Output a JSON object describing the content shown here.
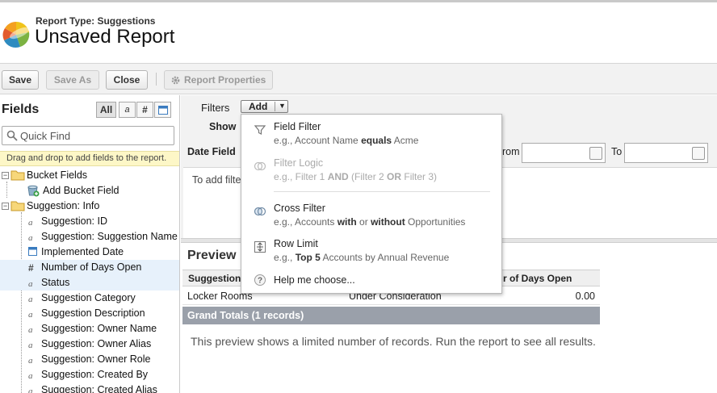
{
  "header": {
    "report_type": "Report Type: Suggestions",
    "title": "Unsaved Report"
  },
  "toolbar": {
    "save_label": "Save",
    "save_as_label": "Save As",
    "close_label": "Close",
    "report_properties_label": "Report Properties"
  },
  "fields_panel": {
    "title": "Fields",
    "toggles": [
      "All",
      "a",
      "#",
      "cal"
    ],
    "quick_find_placeholder": "Quick Find",
    "hint": "Drag and drop to add fields to the report.",
    "tree": [
      {
        "label": "Bucket Fields",
        "type": "folder",
        "icon": "folder-icon"
      },
      {
        "label": "Add Bucket Field",
        "type": "item",
        "icon": "add-bucket-icon"
      },
      {
        "label": "Suggestion: Info",
        "type": "folder",
        "icon": "folder-icon"
      },
      {
        "label": "Suggestion: ID",
        "type": "item",
        "icon": "text-field-icon"
      },
      {
        "label": "Suggestion: Suggestion Name",
        "type": "item",
        "icon": "text-field-icon"
      },
      {
        "label": "Implemented Date",
        "type": "item",
        "icon": "date-field-icon"
      },
      {
        "label": "Number of Days Open",
        "type": "item",
        "icon": "number-field-icon",
        "selected": true
      },
      {
        "label": "Status",
        "type": "item",
        "icon": "text-field-icon",
        "selected": true
      },
      {
        "label": "Suggestion Category",
        "type": "item",
        "icon": "text-field-icon"
      },
      {
        "label": "Suggestion Description",
        "type": "item",
        "icon": "text-field-icon"
      },
      {
        "label": "Suggestion: Owner Name",
        "type": "item",
        "icon": "text-field-icon"
      },
      {
        "label": "Suggestion: Owner Alias",
        "type": "item",
        "icon": "text-field-icon"
      },
      {
        "label": "Suggestion: Owner Role",
        "type": "item",
        "icon": "text-field-icon"
      },
      {
        "label": "Suggestion: Created By",
        "type": "item",
        "icon": "text-field-icon"
      },
      {
        "label": "Suggestion: Created Alias",
        "type": "item",
        "icon": "text-field-icon"
      }
    ]
  },
  "filters": {
    "filters_label": "Filters",
    "add_label": "Add",
    "show_label": "Show",
    "date_field_label": "Date Field",
    "from_label": "rom",
    "to_label": "To",
    "add_hint": "To add filte"
  },
  "add_menu": [
    {
      "title": "Field Filter",
      "sub_parts": [
        [
          "e.g., Account Name ",
          false
        ],
        [
          "equals",
          true
        ],
        [
          " Acme",
          false
        ]
      ],
      "icon": "funnel-icon",
      "disabled": false
    },
    {
      "title": "Filter Logic",
      "sub_parts": [
        [
          "e.g., Filter 1 ",
          false
        ],
        [
          "AND",
          true
        ],
        [
          " (Filter 2 ",
          false
        ],
        [
          "OR",
          true
        ],
        [
          " Filter 3)",
          false
        ]
      ],
      "icon": "venn-icon",
      "disabled": true
    },
    {
      "title": "Cross Filter",
      "sub_parts": [
        [
          "e.g., Accounts ",
          false
        ],
        [
          "with",
          true
        ],
        [
          " or ",
          false
        ],
        [
          "without",
          true
        ],
        [
          " Opportunities",
          false
        ]
      ],
      "icon": "cross-filter-icon",
      "disabled": false
    },
    {
      "title": "Row Limit",
      "sub_parts": [
        [
          "e.g., ",
          false
        ],
        [
          "Top 5",
          true
        ],
        [
          " Accounts by Annual Revenue",
          false
        ]
      ],
      "icon": "row-limit-icon",
      "disabled": false
    },
    {
      "title": "Help me choose...",
      "sub_parts": [],
      "icon": "help-icon",
      "disabled": false
    }
  ],
  "preview": {
    "title": "Preview",
    "columns": [
      "Suggestion:",
      "r of Days Open"
    ],
    "rows": [
      {
        "name": "Locker Rooms",
        "status": "Under Consideration",
        "days": "0.00"
      }
    ],
    "grand_totals": "Grand Totals (1 records)",
    "note": "This preview shows a limited number of records. Run the report to see all results."
  }
}
